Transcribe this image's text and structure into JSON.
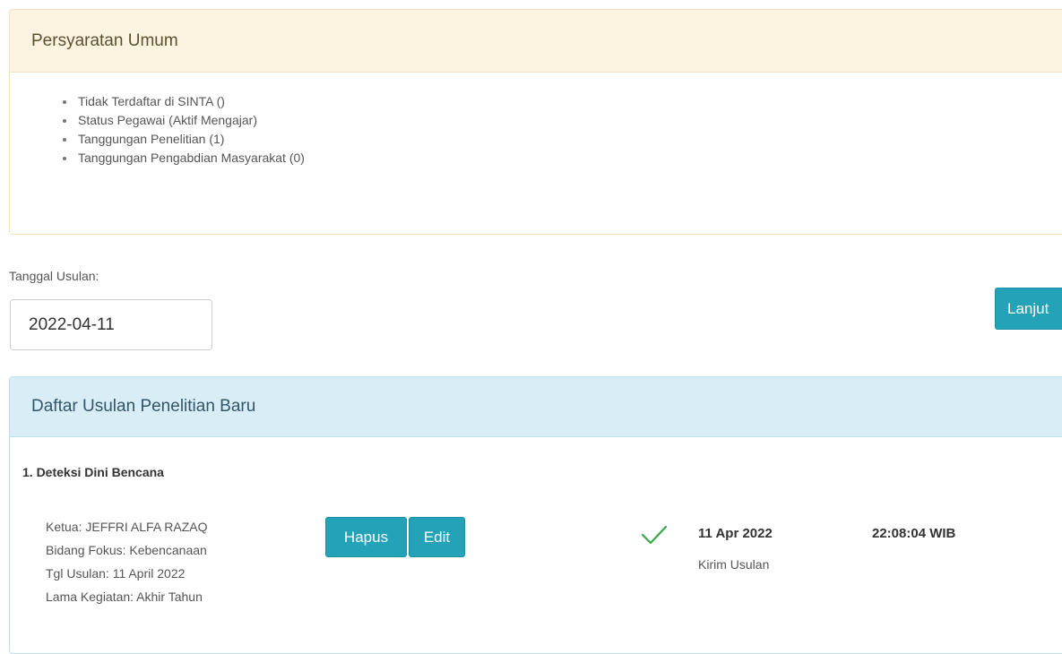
{
  "requirements": {
    "title": "Persyaratan Umum",
    "items": [
      "Tidak Terdaftar di SINTA ()",
      "Status Pegawai (Aktif Mengajar)",
      "Tanggungan Penelitian (1)",
      "Tanggungan Pengabdian Masyarakat (0)"
    ]
  },
  "form": {
    "date_label": "Tanggal Usulan:",
    "date_value": "2022-04-11",
    "next_button": "Lanjut"
  },
  "proposals": {
    "title": "Daftar Usulan Penelitian Baru",
    "items": [
      {
        "title": "1. Deteksi Dini Bencana",
        "ketua": "Ketua: JEFFRI ALFA RAZAQ",
        "bidang": "Bidang Fokus: Kebencanaan",
        "tgl": "Tgl Usulan: 11 April 2022",
        "lama": "Lama Kegiatan: Akhir Tahun",
        "delete_label": "Hapus",
        "edit_label": "Edit",
        "status_date": "11 Apr 2022",
        "status_time": "22:08:04 WIB",
        "status_text": "Kirim Usulan"
      }
    ]
  },
  "colors": {
    "warning_bg": "#fcf3e0",
    "info_bg": "#d9edf7",
    "button": "#23a2b8",
    "check": "#3aa64a"
  },
  "icons": {
    "status": "check-icon"
  }
}
